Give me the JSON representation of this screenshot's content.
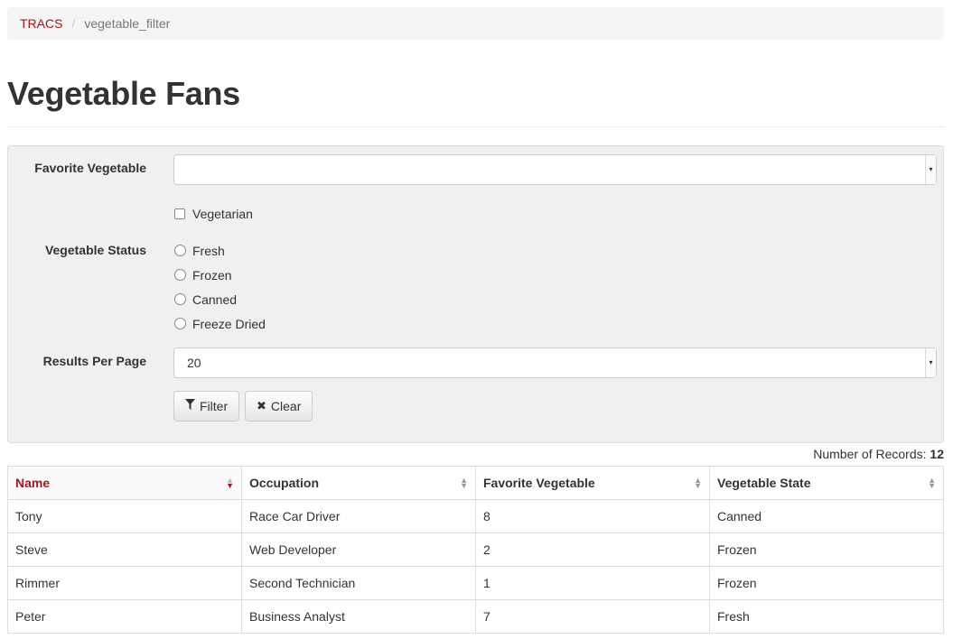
{
  "breadcrumb": {
    "root": "TRACS",
    "separator": "/",
    "current": "vegetable_filter"
  },
  "page": {
    "title": "Vegetable Fans"
  },
  "filter": {
    "favorite_vegetable_label": "Favorite Vegetable",
    "favorite_vegetable_value": "",
    "vegetarian_label": "Vegetarian",
    "status_label": "Vegetable Status",
    "status_options": [
      "Fresh",
      "Frozen",
      "Canned",
      "Freeze Dried"
    ],
    "results_label": "Results Per Page",
    "results_value": "20",
    "filter_button": "Filter",
    "clear_button": "Clear"
  },
  "records": {
    "label": "Number of Records:",
    "count": "12"
  },
  "table": {
    "columns": [
      "Name",
      "Occupation",
      "Favorite Vegetable",
      "Vegetable State"
    ],
    "rows": [
      [
        "Tony",
        "Race Car Driver",
        "8",
        "Canned"
      ],
      [
        "Steve",
        "Web Developer",
        "2",
        "Frozen"
      ],
      [
        "Rimmer",
        "Second Technician",
        "1",
        "Frozen"
      ],
      [
        "Peter",
        "Business Analyst",
        "7",
        "Fresh"
      ]
    ]
  },
  "icons": {
    "filter": "filter-icon",
    "clear": "x-icon",
    "sort": "sort-icon"
  },
  "colors": {
    "accent": "#a5141e",
    "panel_bg": "#f0f0f0",
    "breadcrumb_bg": "#f5f5f5"
  }
}
